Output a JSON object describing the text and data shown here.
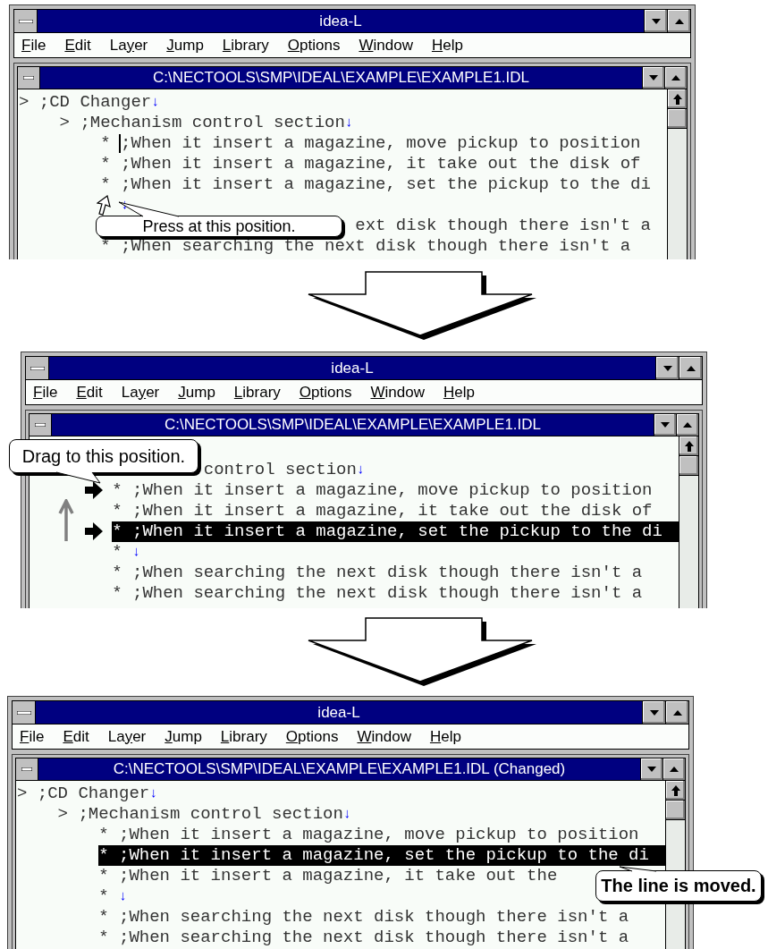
{
  "panels": [
    {
      "window_title": "idea-L",
      "menu": [
        {
          "key": "F",
          "post": "ile"
        },
        {
          "key": "E",
          "post": "dit"
        },
        {
          "pre": "La",
          "key": "y",
          "post": "er"
        },
        {
          "key": "J",
          "post": "ump"
        },
        {
          "key": "L",
          "post": "ibrary"
        },
        {
          "key": "O",
          "post": "ptions"
        },
        {
          "key": "W",
          "post": "indow"
        },
        {
          "key": "H",
          "post": "elp"
        }
      ],
      "document_title": "C:\\NECTOOLS\\SMP\\IDEAL\\EXAMPLE\\EXAMPLE1.IDL",
      "drag_arrow": false,
      "callout": "Press at this position.",
      "lines": [
        {
          "kind": "line",
          "marker": ">",
          "text": ";CD Changer",
          "end_mark": "↓",
          "selected": false,
          "cursor": false,
          "pointer": false,
          "children": [
            {
              "kind": "line",
              "marker": ">",
              "text": ";Mechanism control section",
              "end_mark": "↓",
              "selected": false,
              "cursor": false,
              "pointer": false,
              "children": [
                {
                  "kind": "line",
                  "marker": "*",
                  "text": ";When it insert a magazine, move pickup to position",
                  "selected": false,
                  "cursor": true,
                  "pointer": false
                },
                {
                  "kind": "line",
                  "marker": "*",
                  "text": ";When it insert a magazine, it take out the disk of",
                  "selected": false,
                  "cursor": false,
                  "pointer": false
                },
                {
                  "kind": "line",
                  "marker": "*",
                  "text": ";When it insert a magazine, set the pickup to the di",
                  "selected": false,
                  "cursor": false,
                  "pointer": false
                },
                {
                  "kind": "line",
                  "end_mark": "↓",
                  "selected": false,
                  "cursor": false,
                  "pointer": true
                },
                {
                  "kind": "covered",
                  "text": "ext disk though there isn't a"
                },
                {
                  "kind": "line",
                  "marker": "*",
                  "text": ";When searching the next disk though there isn't a",
                  "selected": false,
                  "cursor": false,
                  "pointer": false
                }
              ]
            }
          ]
        }
      ]
    },
    {
      "window_title": "idea-L",
      "menu": [
        {
          "key": "F",
          "post": "ile"
        },
        {
          "key": "E",
          "post": "dit"
        },
        {
          "pre": "La",
          "key": "y",
          "post": "er"
        },
        {
          "key": "J",
          "post": "ump"
        },
        {
          "key": "L",
          "post": "ibrary"
        },
        {
          "key": "O",
          "post": "ptions"
        },
        {
          "key": "W",
          "post": "indow"
        },
        {
          "key": "H",
          "post": "elp"
        }
      ],
      "document_title": "C:\\NECTOOLS\\SMP\\IDEAL\\EXAMPLE\\EXAMPLE1.IDL",
      "drag_arrow": true,
      "callout": "Drag to this position.",
      "lines": [
        {
          "kind": "covered",
          "children": [
            {
              "kind": "covered",
              "text": "control section",
              "end_mark": "↓",
              "children": [
                {
                  "kind": "line",
                  "marker": "*",
                  "text": ";When it insert a magazine, move pickup to position",
                  "selected": false,
                  "cursor": false,
                  "pointer": false,
                  "marked": true
                },
                {
                  "kind": "line",
                  "marker": "*",
                  "text": ";When it insert a magazine, it take out the disk of",
                  "selected": false,
                  "cursor": false,
                  "pointer": false,
                  "marked": false
                },
                {
                  "kind": "line",
                  "marker": "*",
                  "text": ";When it insert a magazine, set the pickup to the di",
                  "selected": true,
                  "cursor": false,
                  "pointer": false,
                  "marked": true
                },
                {
                  "kind": "line",
                  "marker": "*",
                  "end_mark": "↓",
                  "selected": false,
                  "cursor": false,
                  "pointer": false,
                  "marked": false
                },
                {
                  "kind": "line",
                  "marker": "*",
                  "text": ";When searching the next disk though there isn't a",
                  "selected": false,
                  "cursor": false,
                  "pointer": false,
                  "marked": false
                },
                {
                  "kind": "line",
                  "marker": "*",
                  "text": ";When searching the next disk though there isn't a",
                  "selected": false,
                  "cursor": false,
                  "pointer": false,
                  "marked": false
                }
              ]
            }
          ]
        }
      ]
    },
    {
      "window_title": "idea-L",
      "menu": [
        {
          "key": "F",
          "post": "ile"
        },
        {
          "key": "E",
          "post": "dit"
        },
        {
          "pre": "La",
          "key": "y",
          "post": "er"
        },
        {
          "key": "J",
          "post": "ump"
        },
        {
          "key": "L",
          "post": "ibrary"
        },
        {
          "key": "O",
          "post": "ptions"
        },
        {
          "key": "W",
          "post": "indow"
        },
        {
          "key": "H",
          "post": "elp"
        }
      ],
      "document_title": "C:\\NECTOOLS\\SMP\\IDEAL\\EXAMPLE\\EXAMPLE1.IDL (Changed)",
      "drag_arrow": false,
      "callout": "The line is moved.",
      "lines": [
        {
          "kind": "line",
          "marker": ">",
          "text": ";CD Changer",
          "end_mark": "↓",
          "selected": false,
          "cursor": false,
          "pointer": false,
          "children": [
            {
              "kind": "line",
              "marker": ">",
              "text": ";Mechanism control section",
              "end_mark": "↓",
              "selected": false,
              "cursor": false,
              "pointer": false,
              "children": [
                {
                  "kind": "line",
                  "marker": "*",
                  "text": ";When it insert a magazine, move pickup to position",
                  "selected": false,
                  "cursor": false,
                  "pointer": false
                },
                {
                  "kind": "line",
                  "marker": "*",
                  "text": ";When it insert a magazine, set the pickup to the di",
                  "selected": true,
                  "cursor": false,
                  "pointer": false
                },
                {
                  "kind": "line",
                  "marker": "*",
                  "text": ";When it insert a magazine, it take out the",
                  "selected": false,
                  "cursor": false,
                  "pointer": false
                },
                {
                  "kind": "line",
                  "marker": "*",
                  "end_mark": "↓",
                  "selected": false,
                  "cursor": false,
                  "pointer": false
                },
                {
                  "kind": "line",
                  "marker": "*",
                  "text": ";When searching the next disk though there isn't a",
                  "selected": false,
                  "cursor": false,
                  "pointer": false
                },
                {
                  "kind": "line",
                  "marker": "*",
                  "text": ";When searching the next disk though there isn't a",
                  "selected": false,
                  "cursor": false,
                  "pointer": false
                }
              ]
            }
          ]
        }
      ]
    }
  ]
}
